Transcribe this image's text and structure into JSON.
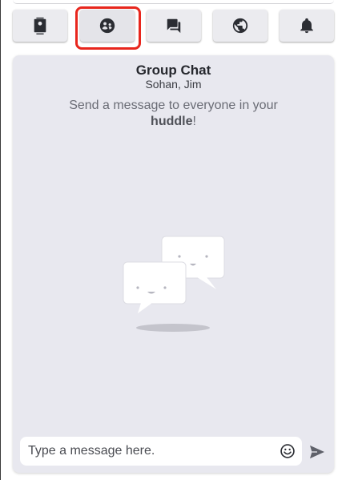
{
  "toolbar": {
    "buttons": [
      {
        "icon": "contacts-icon",
        "active": false
      },
      {
        "icon": "group-icon",
        "active": true
      },
      {
        "icon": "chat-bubbles-icon",
        "active": false
      },
      {
        "icon": "globe-icon",
        "active": false
      },
      {
        "icon": "bell-icon",
        "active": false
      }
    ],
    "highlight_color": "#e8261d"
  },
  "chat": {
    "title": "Group Chat",
    "members": "Sohan, Jim",
    "intro_prefix": "Send a message to everyone in your ",
    "intro_emphasis": "huddle",
    "intro_suffix": "!"
  },
  "composer": {
    "placeholder": "Type a message here.",
    "value": "",
    "emoji_icon": "smiley-icon",
    "send_icon": "send-icon"
  },
  "colors": {
    "panel_bg": "#e8e8ef",
    "button_bg": "#ebebef",
    "icon": "#2b2d33",
    "muted_text": "#6a6c75"
  }
}
